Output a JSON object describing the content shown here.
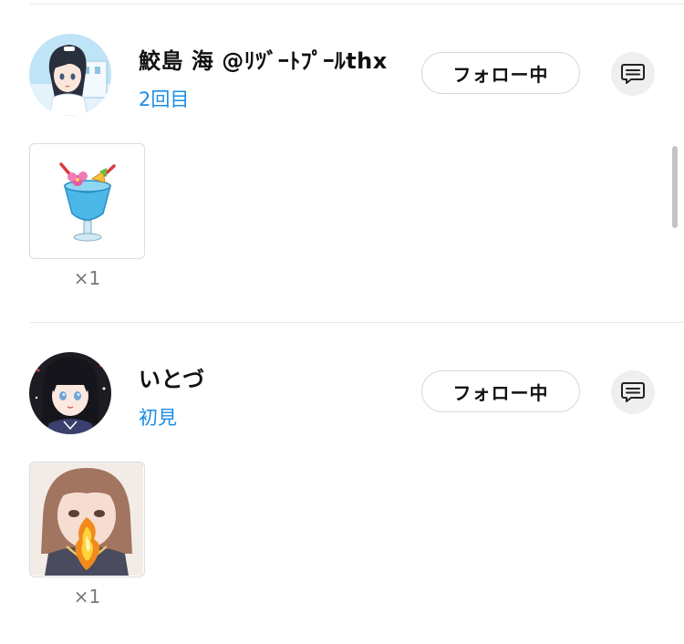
{
  "follow_list": [
    {
      "name": "鮫島 海 @ﾘﾂﾞｰﾄﾌﾟｰﾙthx",
      "visit_label": "2回目",
      "follow_button_label": "フォロー中",
      "avatar_icon": "anime-girl-dark-hair-avatar",
      "comment_icon": "message-icon",
      "gift": {
        "icon": "tropical-drink-icon",
        "count_label": "×1"
      }
    },
    {
      "name": "いとづ",
      "visit_label": "初見",
      "follow_button_label": "フォロー中",
      "avatar_icon": "anime-girl-black-bob-avatar",
      "comment_icon": "message-icon",
      "gift": {
        "icon": "fire-breath-girl-icon",
        "count_label": "×1"
      }
    }
  ],
  "colors": {
    "visit_label": "#1a8de6",
    "divider": "#e8e8e8",
    "button_border": "#d9d9d9",
    "comment_button_bg": "#efefef"
  }
}
